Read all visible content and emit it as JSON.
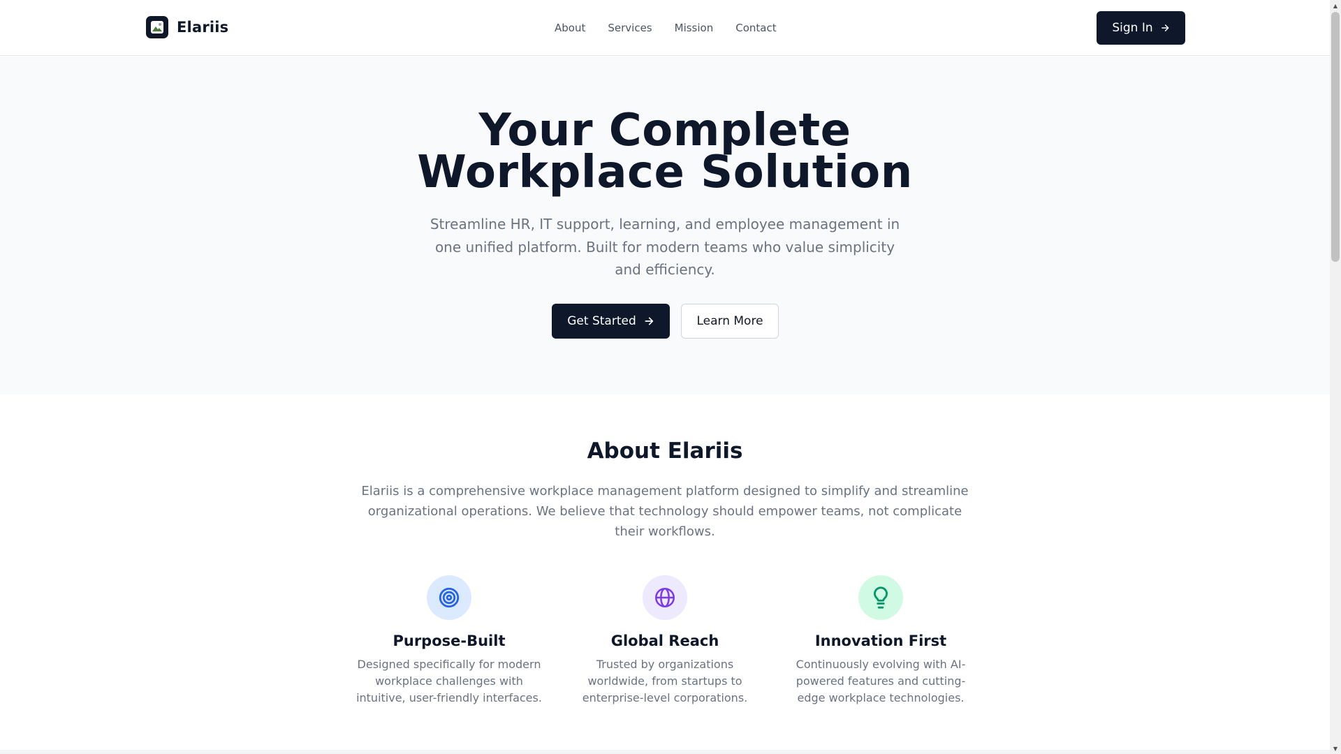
{
  "header": {
    "brand_name": "Elariis",
    "nav": [
      {
        "label": "About"
      },
      {
        "label": "Services"
      },
      {
        "label": "Mission"
      },
      {
        "label": "Contact"
      }
    ],
    "signin_label": "Sign In"
  },
  "hero": {
    "title_line1": "Your Complete",
    "title_line2": "Workplace Solution",
    "subtitle": "Streamline HR, IT support, learning, and employee management in one unified platform. Built for modern teams who value simplicity and efficiency.",
    "primary_label": "Get Started",
    "secondary_label": "Learn More"
  },
  "about": {
    "title": "About Elariis",
    "description": "Elariis is a comprehensive workplace management platform designed to simplify and streamline organizational operations. We believe that technology should empower teams, not complicate their workflows.",
    "features": [
      {
        "icon": "target-icon",
        "title": "Purpose-Built",
        "description": "Designed specifically for modern workplace challenges with intuitive, user-friendly interfaces.",
        "bg": "#dbeafe",
        "color": "#2563eb"
      },
      {
        "icon": "globe-icon",
        "title": "Global Reach",
        "description": "Trusted by organizations worldwide, from startups to enterprise-level corporations.",
        "bg": "#ede9fe",
        "color": "#7c3aed"
      },
      {
        "icon": "lightbulb-icon",
        "title": "Innovation First",
        "description": "Continuously evolving with AI-powered features and cutting-edge workplace technologies.",
        "bg": "#d1fae5",
        "color": "#059669"
      }
    ]
  },
  "colors": {
    "primary": "#0f172a",
    "muted_text": "#6b7280",
    "hero_bg": "#f9fafb"
  }
}
